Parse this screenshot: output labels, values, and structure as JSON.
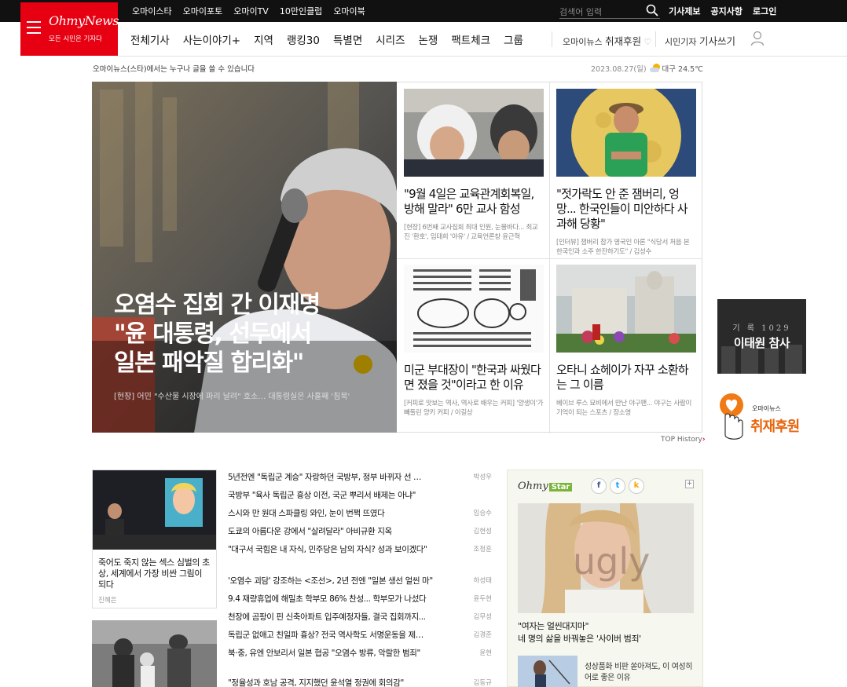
{
  "topbar": {
    "links": [
      "오마이스타",
      "오마이포토",
      "오마이TV",
      "10만인클럽",
      "오마이북"
    ],
    "search_placeholder": "검색어 입력",
    "right_links": [
      "기사제보",
      "공지사항",
      "로그인"
    ]
  },
  "logo": {
    "name": "OhmyNews",
    "slogan": "모든 시민은 기자다"
  },
  "nav": {
    "items": [
      "전체기사",
      "사는이야기+",
      "지역",
      "랭킹30",
      "특별면",
      "시리즈",
      "논쟁",
      "팩트체크",
      "그룹"
    ],
    "sponsor_prefix": "오마이뉴스",
    "sponsor_label": "취재후원",
    "writer_prefix": "시민기자",
    "writer_label": "기사쓰기"
  },
  "info": {
    "tagline": "오마이뉴스(스타)에서는 누구나 글을 쓸 수 있습니다",
    "date": "2023.08.27(일)",
    "weather": "대구 24.5℃"
  },
  "hero": {
    "title_lines": [
      "오염수 집회 간 이재명",
      "\"윤 대통령, 선두에서",
      "일본 패악질 합리화\""
    ],
    "subtitle": "[현장] 어민 \"수산물 시장에 파리 날려\" 호소… 대통령실은 사흘째 '침묵'"
  },
  "cards": [
    {
      "title": "\"9월 4일은 교육관계회복일, 방해 말라\" 6만 교사 함성",
      "desc": "[현장] 6번째 교사집회 최대 인원, 눈물바다... 최교진 '환호', 임태희 '야유' / 교육언론창 윤근혁"
    },
    {
      "title": "\"젓가락도 안 준 잼버리, 엉망... 한국인들이 미안하다 사과해 당황\"",
      "desc": "[인터뷰] 잼버리 참가 영국인 아론 \"식당서 처음 본 한국인과 소주 한잔하기도\" / 김성수"
    },
    {
      "title": "미군 부대장이 \"한국과 싸웠다면 졌을 것\"이라고 한 이유",
      "desc": "[커피로 맛보는 역사, 역사로 배우는 커피] '양생이'가 빼돌린 양키 커피 / 이길상"
    },
    {
      "title": "오타니 쇼헤이가 자꾸 소환하는 그 이름",
      "desc": "베이브 루스 묘비에서 만난 야구팬... 야구는 사람이 기억이 되는 스포츠 / 장소영"
    }
  ],
  "top_history": "TOP History",
  "banners": {
    "memorial_top": "기 록  1029",
    "memorial_main": "이태원 참사",
    "sponsor_small": "오마이뉴스",
    "sponsor_main": "취재후원"
  },
  "lower_card": {
    "title": "죽어도 죽지 않는 섹스 심벌의 초상, 세계에서 가장 비싼 그림이 되다",
    "author": "진혜은"
  },
  "headlines": [
    {
      "title": "5년전엔 \"독립군 계승\" 자랑하던 국방부, 정부 바뀌자 선 …",
      "author": "박성우"
    },
    {
      "title": "국방부 \"육사 독립군 흉상 이전, 국군 뿌리서 배제는 아냐\"",
      "author": ""
    },
    {
      "title": "스시와 만 원대 스파클링 와인, 눈이 번쩍 뜨였다",
      "author": "임승수"
    },
    {
      "title": "도쿄의 아름다운 강에서 \"살려달라\" 아비규환 지옥",
      "author": "김현성"
    },
    {
      "title": "\"대구서 국힘은 내 자식, 민주당은 남의 자식? 성과 보이겠다\"",
      "author": "조정훈"
    },
    {
      "title": "'오염수 괴담' 강조하는 <조선>, 2년 전엔 \"일본 생선 얼씬 마\"",
      "author": "하성태"
    },
    {
      "title": "9.4 재량휴업에 해밀초 학부모 86% 찬성... 학부모가 나섰다",
      "author": "윤두현"
    },
    {
      "title": "천장에 곰팡이 핀 신축아파트 입주예정자들, 결국 집회까지...",
      "author": "김무성"
    },
    {
      "title": "독립군 없애고 친일파 흉상? 전국 역사학도 서명운동을 제…",
      "author": "김경준"
    },
    {
      "title": "북·중, 유엔 안보리서 일본 협공 \"오염수 방류, 악랄한 범죄\"",
      "author": "윤현"
    },
    {
      "title": "\"정율성과 호남 공격, 지지했던 윤석열 정권에 회의감\"",
      "author": "김동규"
    }
  ],
  "star": {
    "logo": "Ohmy",
    "logo_badge": "Star",
    "caption1": "\"여자는 얼씬대지마\"",
    "caption2": "네 명의 삶을 바꿔놓은 '사이버 범죄'",
    "photo_text": "ugly",
    "sub_caption": "성상품화 비판 쏟아져도, 이 여성히어로 좋은 이유"
  },
  "colors": {
    "brand_red": "#e60012",
    "star_green": "#7bb43c",
    "sponsor_orange": "#e8640c"
  }
}
